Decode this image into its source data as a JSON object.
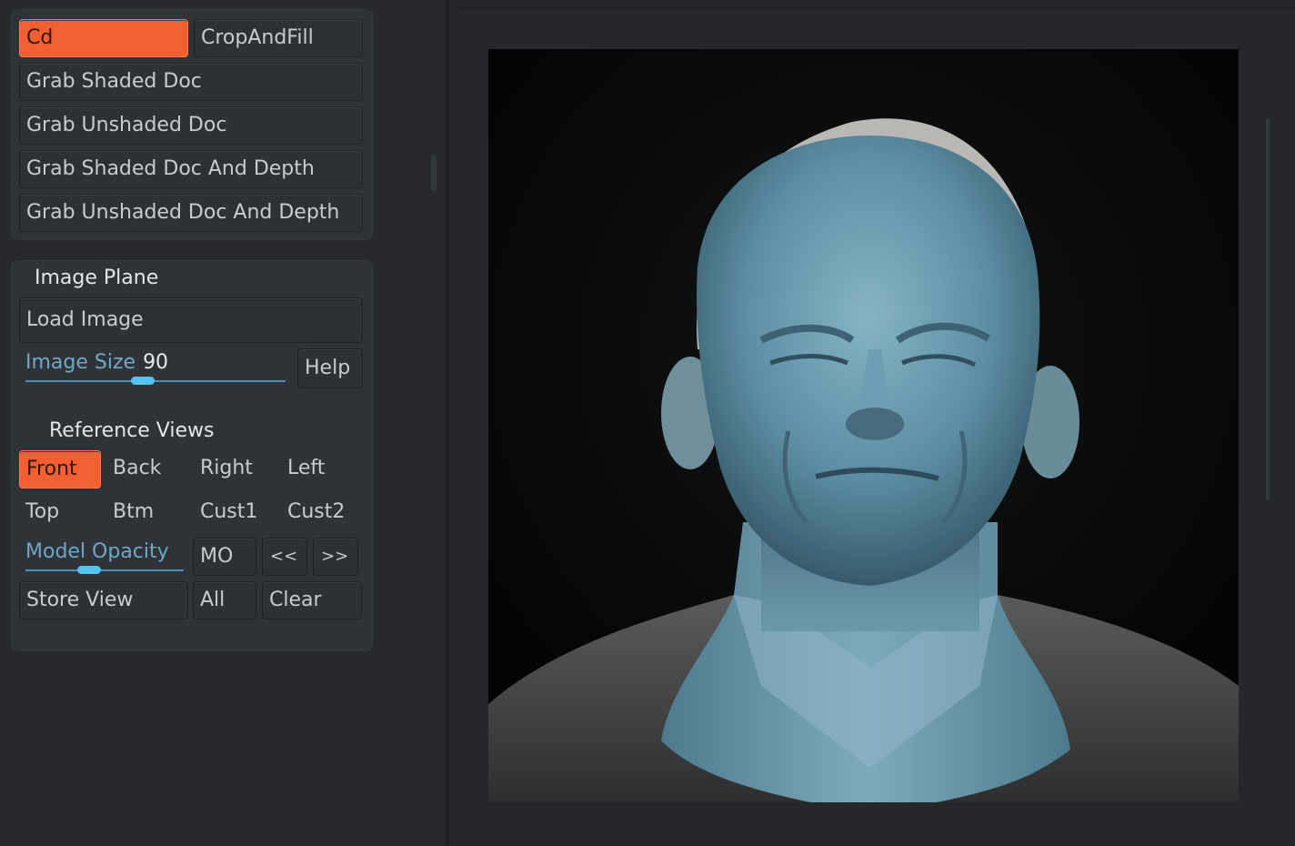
{
  "document_panel": {
    "cd_label": "Cd",
    "crop_fill_label": "CropAndFill",
    "grab_shaded_label": "Grab Shaded Doc",
    "grab_unshaded_label": "Grab Unshaded Doc",
    "grab_shaded_depth_label": "Grab Shaded Doc And Depth",
    "grab_unshaded_depth_label": "Grab Unshaded Doc And Depth"
  },
  "image_plane": {
    "title": "Image Plane",
    "load_image_label": "Load Image",
    "image_size_label": "Image Size",
    "image_size_value": "90",
    "image_size_fraction": 0.45,
    "help_label": "Help",
    "reference_views_title": "Reference Views",
    "views": [
      {
        "label": "Front",
        "active": true
      },
      {
        "label": "Back",
        "active": false
      },
      {
        "label": "Right",
        "active": false
      },
      {
        "label": "Left",
        "active": false
      },
      {
        "label": "Top",
        "active": false
      },
      {
        "label": "Btm",
        "active": false
      },
      {
        "label": "Cust1",
        "active": false
      },
      {
        "label": "Cust2",
        "active": false
      }
    ],
    "model_opacity_label": "Model Opacity",
    "model_opacity_fraction": 0.4,
    "mo_label": "MO",
    "prev_label": "<<",
    "next_label": ">>",
    "store_view_label": "Store View",
    "all_label": "All",
    "clear_label": "Clear"
  },
  "colors": {
    "accent": "#f25f33",
    "slider_blue": "#53c3ef",
    "model_tint": "#5f8ea3",
    "background": "#25272b"
  }
}
